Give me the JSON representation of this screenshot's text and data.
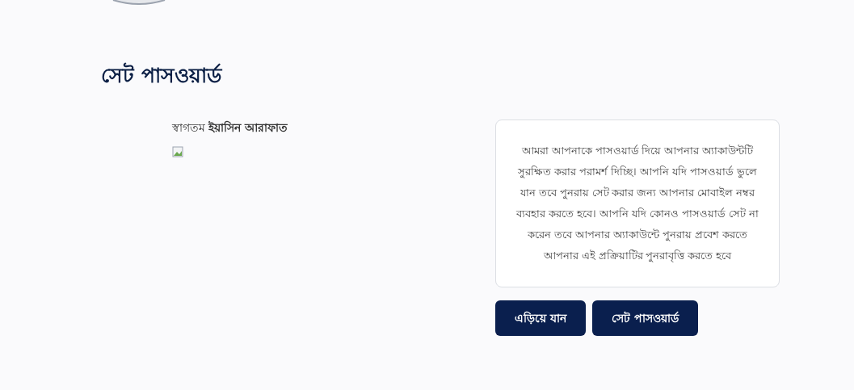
{
  "page_title": "সেট পাসওয়ার্ড",
  "welcome": "স্বাগতম **ইয়াসিন আরাফাত**",
  "info_text": "আমরা আপনাকে পাসওয়ার্ড দিয়ে আপনার অ্যাকাউন্টটি সুরক্ষিত করার পরামর্শ দিচ্ছি। আপনি যদি পাসওয়ার্ড ভুলে যান তবে পুনরায় সেট করার জন্য আপনার মোবাইল নম্বর ব্যবহার করতে হবে। আপনি যদি কোনও পাসওয়ার্ড সেট না করেন তবে আপনার অ্যাকাউন্টে পুনরায় প্রবেশ করতে আপনার এই প্রক্রিয়াটির পুনরাবৃত্তি করতে হবে",
  "buttons": [
    {
      "label": "এড়িয়ে যান"
    },
    {
      "label": "সেট পাসওয়ার্ড"
    }
  ]
}
